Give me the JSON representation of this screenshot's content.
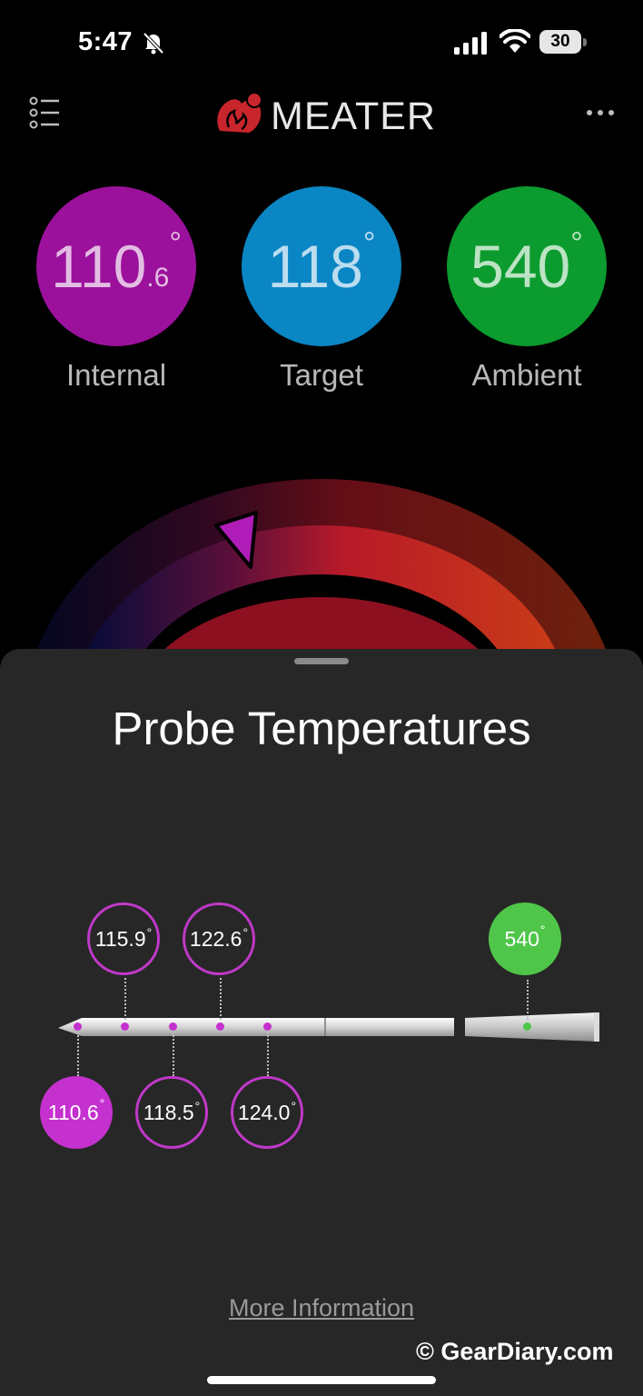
{
  "status_bar": {
    "time": "5:47",
    "battery_level": "30",
    "icons": [
      "bell-slash-icon",
      "signal-icon",
      "wifi-icon",
      "battery-icon"
    ]
  },
  "header": {
    "brand": "MEATER",
    "icons": [
      "menu-list-icon",
      "meater-logo",
      "more-icon"
    ]
  },
  "temperatures": [
    {
      "key": "internal",
      "main": "110",
      "fraction": ".6",
      "deg": "°",
      "label": "Internal",
      "color": "#9b119b"
    },
    {
      "key": "target",
      "main": "118",
      "fraction": "",
      "deg": "°",
      "label": "Target",
      "color": "#0b86c4"
    },
    {
      "key": "ambient",
      "main": "540",
      "fraction": "",
      "deg": "°",
      "label": "Ambient",
      "color": "#0c9b2e"
    }
  ],
  "sheet": {
    "title": "Probe Temperatures",
    "more_info": "More Information"
  },
  "probe_sensors": {
    "tip": {
      "value": "110.6",
      "deg": "°"
    },
    "sensor_2": {
      "value": "115.9",
      "deg": "°"
    },
    "sensor_3": {
      "value": "118.5",
      "deg": "°"
    },
    "sensor_4": {
      "value": "122.6",
      "deg": "°"
    },
    "sensor_5": {
      "value": "124.0",
      "deg": "°"
    },
    "ambient": {
      "value": "540",
      "deg": "°"
    }
  },
  "colors": {
    "sensor_purple": "#c531cf",
    "ambient_green": "#4fc64a",
    "sheet_bg": "#272727"
  },
  "watermark": "© GearDiary.com"
}
